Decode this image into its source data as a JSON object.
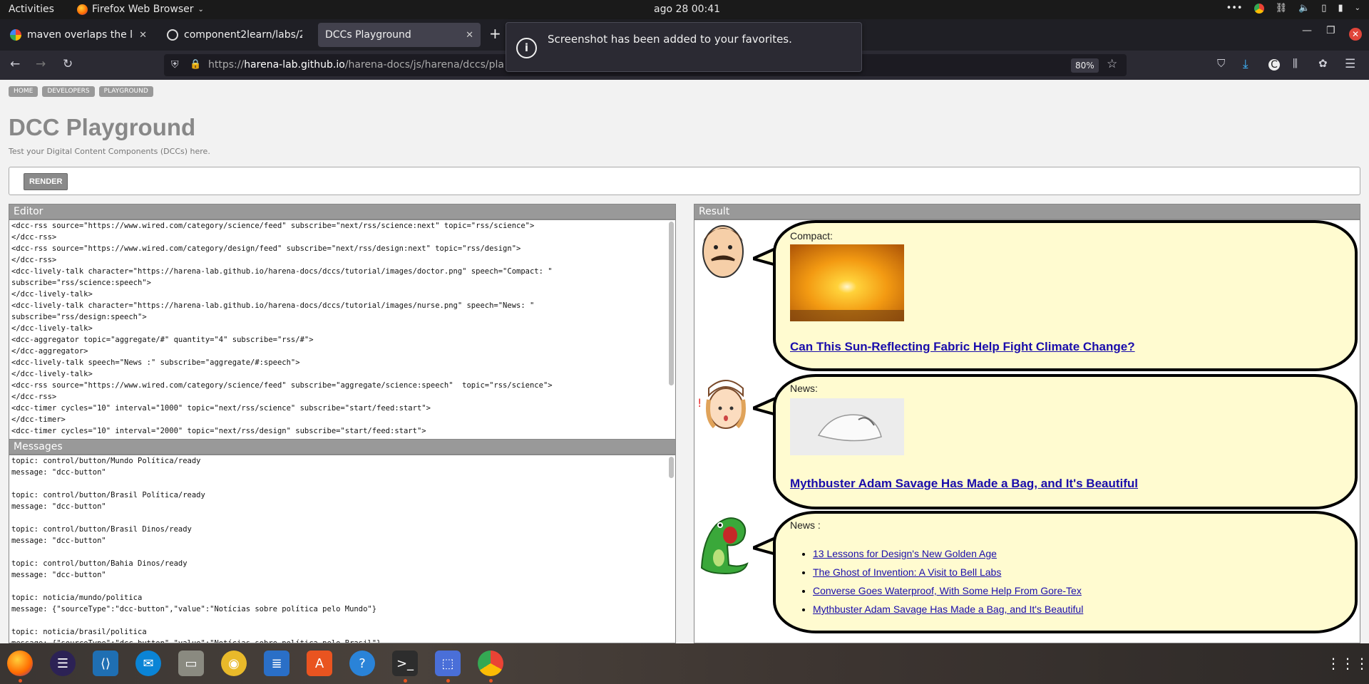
{
  "topbar": {
    "activities": "Activities",
    "app_name": "Firefox Web Browser",
    "clock": "ago 28  00:41"
  },
  "tabs": [
    {
      "title": "maven overlaps the locat",
      "icon": "google-icon"
    },
    {
      "title": "component2learn/labs/2",
      "icon": "github-icon"
    },
    {
      "title": "DCCs Playground",
      "icon": "none",
      "active": true
    }
  ],
  "urlbar": {
    "host_prefix": "https://",
    "host": "harena-lab.github.io",
    "path": "/harena-docs/js/harena/dccs/pla",
    "zoom": "80%"
  },
  "notification": {
    "message": "Screenshot has been added to your favorites."
  },
  "page": {
    "breadcrumbs": [
      "HOME",
      "DEVELOPERS",
      "PLAYGROUND"
    ],
    "title": "DCC Playground",
    "subtitle": "Test your Digital Content Components (DCCs) here.",
    "render_label": "RENDER",
    "editor_title": "Editor",
    "messages_title": "Messages",
    "result_title": "Result",
    "editor_lines": [
      "<dcc-rss source=\"https://www.wired.com/category/science/feed\" subscribe=\"next/rss/science:next\" topic=\"rss/science\">",
      "</dcc-rss>",
      "<dcc-rss source=\"https://www.wired.com/category/design/feed\" subscribe=\"next/rss/design:next\" topic=\"rss/design\">",
      "</dcc-rss>",
      "<dcc-lively-talk character=\"https://harena-lab.github.io/harena-docs/dccs/tutorial/images/doctor.png\" speech=\"Compact: \"",
      "subscribe=\"rss/science:speech\">",
      "</dcc-lively-talk>",
      "<dcc-lively-talk character=\"https://harena-lab.github.io/harena-docs/dccs/tutorial/images/nurse.png\" speech=\"News: \"",
      "subscribe=\"rss/design:speech\">",
      "</dcc-lively-talk>",
      "<dcc-aggregator topic=\"aggregate/#\" quantity=\"4\" subscribe=\"rss/#\">",
      "</dcc-aggregator>",
      "<dcc-lively-talk speech=\"News :\" subscribe=\"aggregate/#:speech\">",
      "</dcc-lively-talk>",
      "<dcc-rss source=\"https://www.wired.com/category/science/feed\" subscribe=\"aggregate/science:speech\"  topic=\"rss/science\">",
      "</dcc-rss>",
      "<dcc-timer cycles=\"10\" interval=\"1000\" topic=\"next/rss/science\" subscribe=\"start/feed:start\">",
      "</dcc-timer>",
      "<dcc-timer cycles=\"10\" interval=\"2000\" topic=\"next/rss/design\" subscribe=\"start/feed:start\">"
    ],
    "message_lines": [
      "topic: control/button/Mundo Política/ready",
      "message: \"dcc-button\"",
      "",
      "topic: control/button/Brasil Política/ready",
      "message: \"dcc-button\"",
      "",
      "topic: control/button/Brasil Dinos/ready",
      "message: \"dcc-button\"",
      "",
      "topic: control/button/Bahia Dinos/ready",
      "message: \"dcc-button\"",
      "",
      "topic: noticia/mundo/politica",
      "message: {\"sourceType\":\"dcc-button\",\"value\":\"Notícias sobre política pelo Mundo\"}",
      "",
      "topic: noticia/brasil/politica",
      "message: {\"sourceType\":\"dcc-button\",\"value\":\"Notícias sobre política pelo Brasil\"}"
    ]
  },
  "result": {
    "talks": [
      {
        "label": "Compact:",
        "headline": "Can This Sun-Reflecting Fabric Help Fight Climate Change?",
        "character": "doctor"
      },
      {
        "label": "News:",
        "headline": "Mythbuster Adam Savage Has Made a Bag, and It's Beautiful",
        "character": "nurse"
      },
      {
        "label": "News :",
        "character": "dinosaur",
        "items": [
          "13 Lessons for Design's New Golden Age",
          "The Ghost of Invention: A Visit to Bell Labs",
          "Converse Goes Waterproof, With Some Help From Gore-Tex",
          "Mythbuster Adam Savage Has Made a Bag, and It's Beautiful"
        ]
      }
    ]
  },
  "colors": {
    "bubble_fill": "#fffbd0",
    "link": "#1a0dab",
    "panel_header": "#999999",
    "ubuntu_orange": "#e95420"
  },
  "dock": [
    "firefox-icon",
    "eclipse-icon",
    "vscode-icon",
    "thunderbird-icon",
    "files-icon",
    "rhythmbox-icon",
    "writer-icon",
    "software-icon",
    "help-icon",
    "terminal-icon",
    "screenshot-icon",
    "chrome-icon",
    "apps-grid-icon"
  ]
}
